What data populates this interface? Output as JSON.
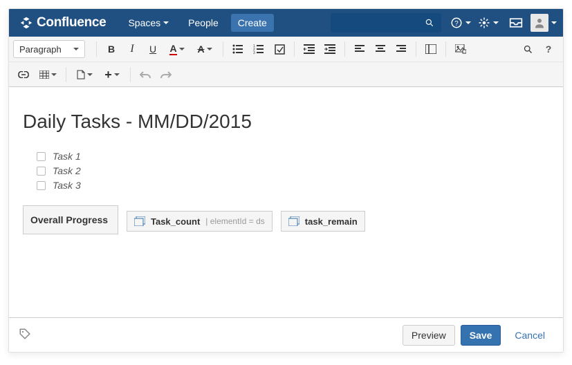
{
  "header": {
    "product": "Confluence",
    "nav": {
      "spaces": "Spaces",
      "people": "People",
      "create": "Create"
    }
  },
  "toolbar": {
    "paragraph_label": "Paragraph"
  },
  "page": {
    "title": "Daily Tasks - MM/DD/2015",
    "tasks": [
      "Task 1",
      "Task 2",
      "Task 3"
    ],
    "progress_label": "Overall Progress",
    "macros": [
      {
        "name": "Task_count",
        "param": "elementId = ds"
      },
      {
        "name": "task_remain",
        "param": ""
      }
    ]
  },
  "footer": {
    "preview": "Preview",
    "save": "Save",
    "cancel": "Cancel"
  }
}
